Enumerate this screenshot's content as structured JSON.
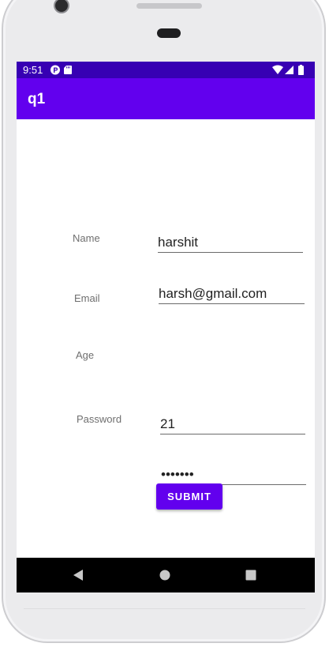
{
  "status_bar": {
    "time": "9:51",
    "left_icons": [
      "p-badge-icon",
      "sd-card-icon"
    ],
    "right_icons": [
      "wifi-icon",
      "signal-icon",
      "battery-icon"
    ]
  },
  "app_bar": {
    "title": "q1"
  },
  "form": {
    "fields": [
      {
        "label": "Name",
        "value": "harshit"
      },
      {
        "label": "Email",
        "value": "harsh@gmail.com"
      },
      {
        "label": "Age",
        "value": "21"
      },
      {
        "label": "Password",
        "value": "•••••••"
      }
    ],
    "submit_label": "SUBMIT"
  },
  "navigation": {
    "buttons": [
      "back-icon",
      "home-icon",
      "recents-icon"
    ]
  },
  "colors": {
    "status_bar": "#3700b3",
    "app_bar": "#6200ee",
    "accent": "#6200ee",
    "nav_bar": "#000000"
  }
}
